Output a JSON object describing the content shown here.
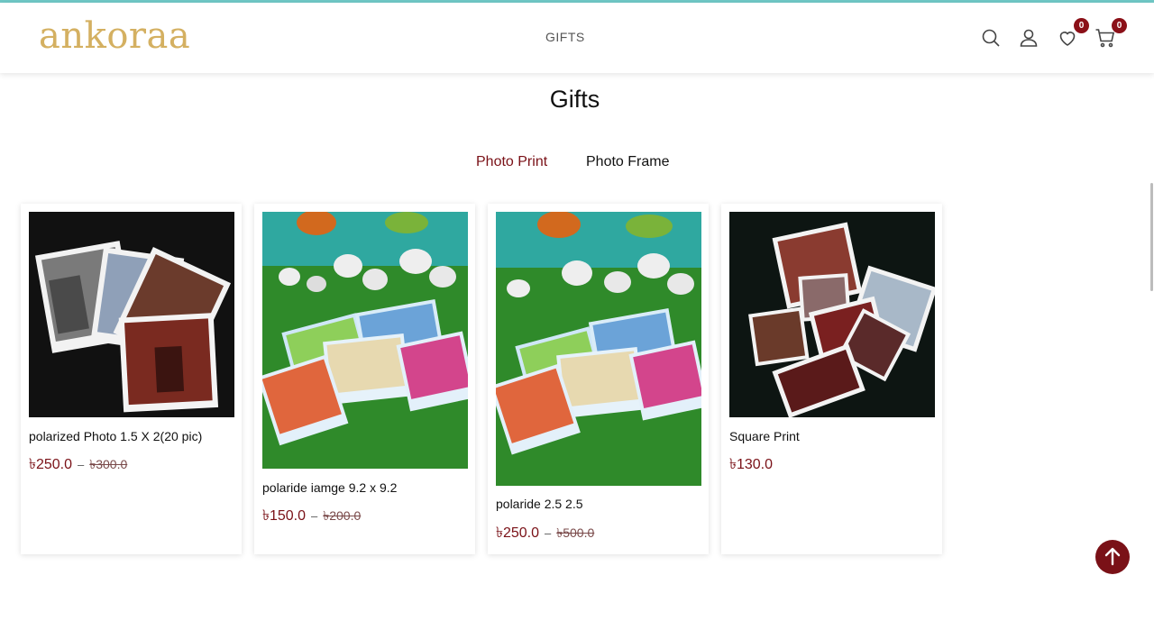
{
  "brand": {
    "logo_text": "ankoraa",
    "accent": "#7a1117",
    "logo_color": "#d4b061",
    "topline_color": "#6fc7c5"
  },
  "nav": {
    "items": [
      {
        "label": "GIFTS"
      }
    ]
  },
  "header_icons": {
    "search": "search-icon",
    "account": "user-icon",
    "wishlist": {
      "icon": "heart-icon",
      "count": "0"
    },
    "cart": {
      "icon": "cart-icon",
      "count": "0"
    }
  },
  "page": {
    "title": "Gifts"
  },
  "tabs": [
    {
      "label": "Photo Print",
      "active": true
    },
    {
      "label": "Photo Frame",
      "active": false
    }
  ],
  "products": [
    {
      "name": "polarized Photo 1.5 X 2(20 pic)",
      "price": "৳250.0",
      "separator": "–",
      "old_price": "৳300.0"
    },
    {
      "name": "polaride iamge 9.2 x 9.2",
      "price": "৳150.0",
      "separator": "–",
      "old_price": "৳200.0"
    },
    {
      "name": "polaride 2.5 2.5",
      "price": "৳250.0",
      "separator": "–",
      "old_price": "৳500.0"
    },
    {
      "name": "Square Print",
      "price": "৳130.0"
    }
  ],
  "scroll_top": {
    "icon": "arrow-up-icon"
  }
}
